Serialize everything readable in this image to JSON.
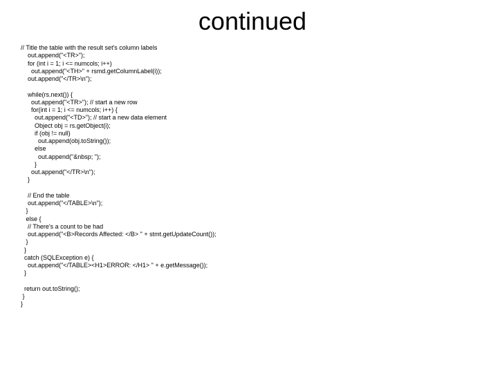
{
  "title": "continued",
  "code": "// Title the table with the result set's column labels\n    out.append(\"<TR>\");\n    for (int i = 1; i <= numcols; i++)\n      out.append(\"<TH>\" + rsmd.getColumnLabel(i));\n    out.append(\"</TR>\\n\");\n\n    while(rs.next()) {\n      out.append(\"<TR>\"); // start a new row\n      for(int i = 1; i <= numcols; i++) {\n        out.append(\"<TD>\"); // start a new data element\n        Object obj = rs.getObject(i);\n        if (obj != null)\n          out.append(obj.toString());\n        else\n          out.append(\"&nbsp; \");\n        }\n      out.append(\"</TR>\\n\");\n    }\n\n    // End the table\n    out.append(\"</TABLE>\\n\");\n   }\n   else {\n    // There's a count to be had\n    out.append(\"<B>Records Affected: </B> \" + stmt.getUpdateCount());\n   }\n  }\n  catch (SQLException e) {\n    out.append(\"</TABLE><H1>ERROR: </H1> \" + e.getMessage());\n  }\n\n  return out.toString();\n }\n}"
}
